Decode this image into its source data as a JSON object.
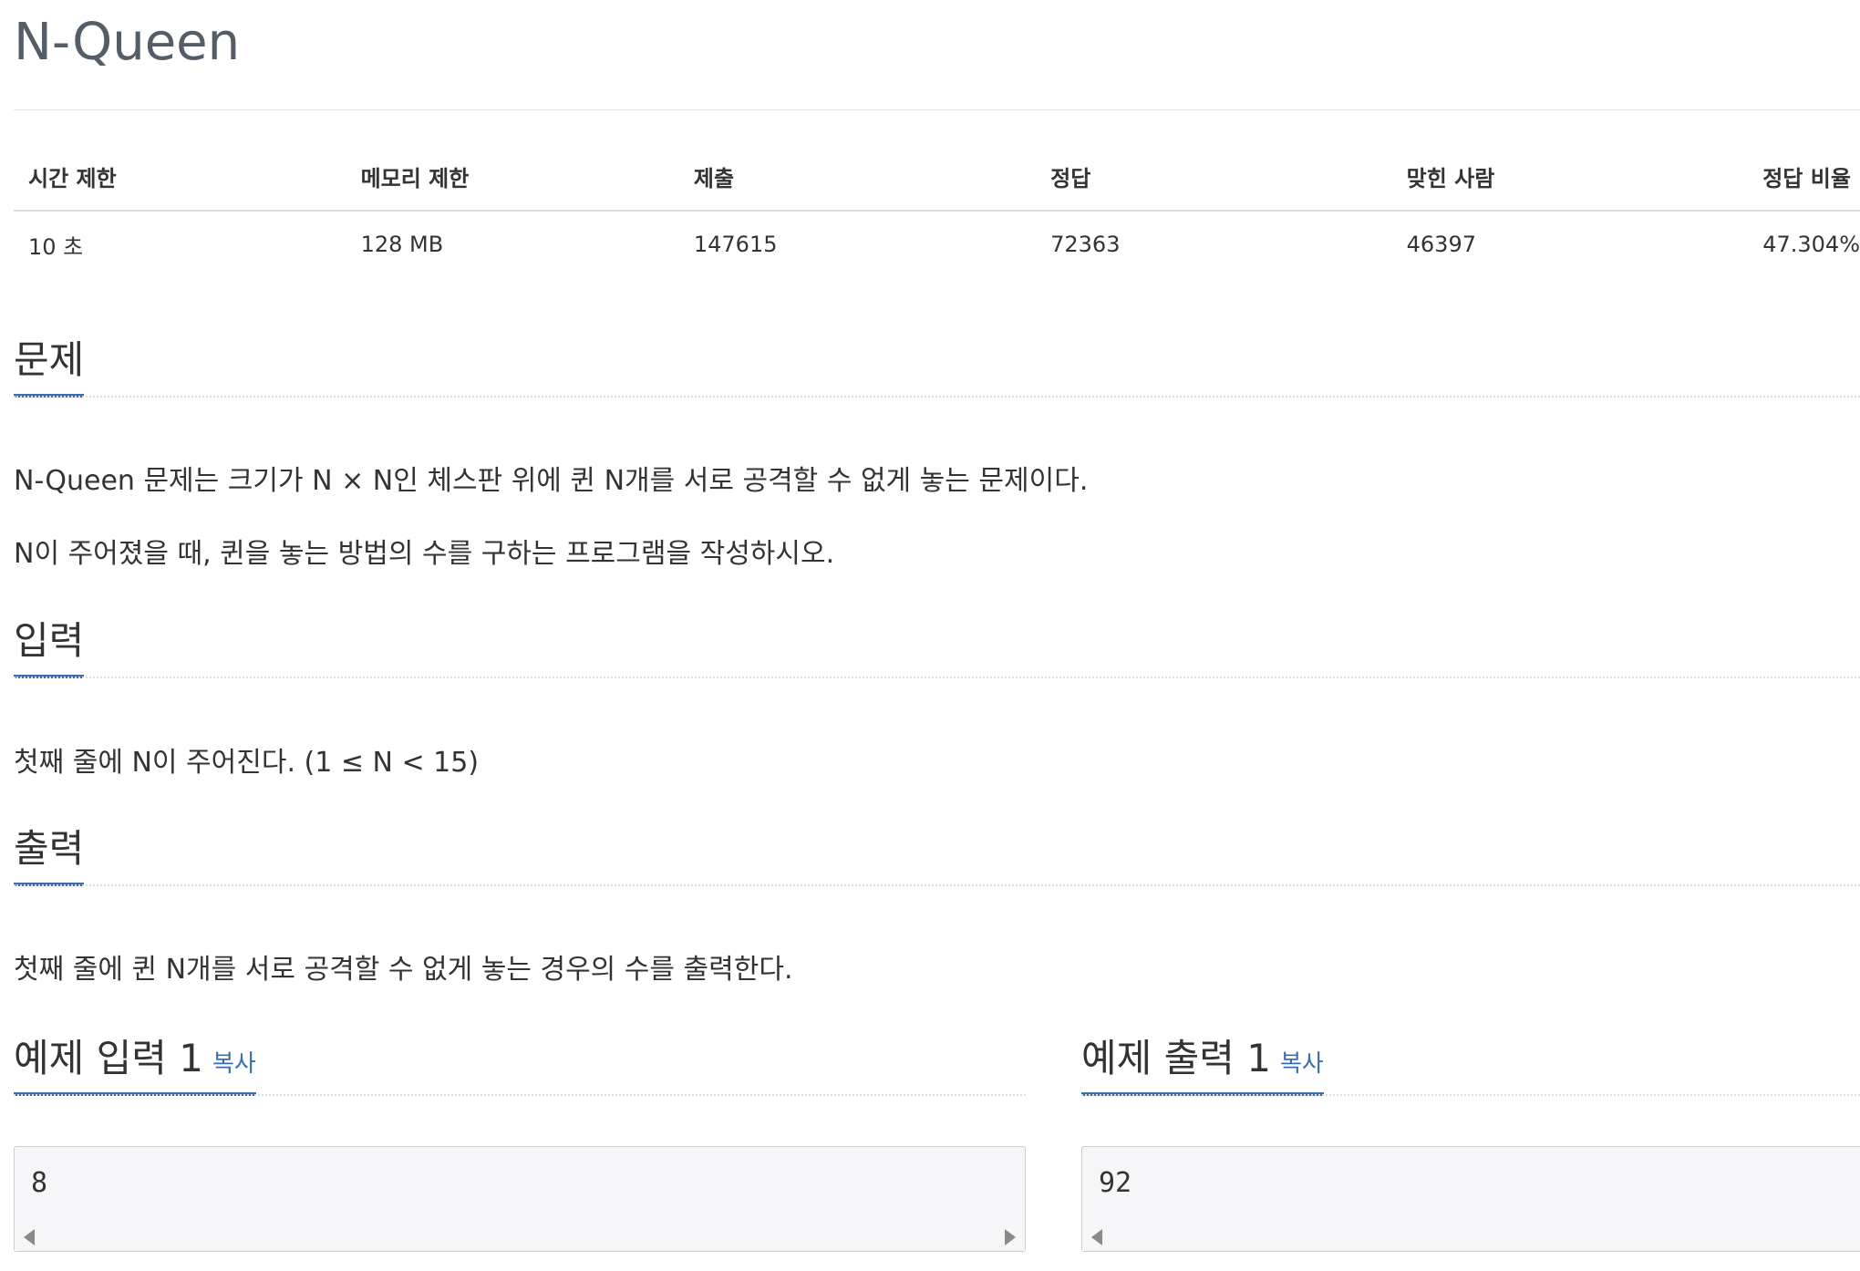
{
  "problem": {
    "title": "N-Queen"
  },
  "info_table": {
    "headers": [
      "시간 제한",
      "메모리 제한",
      "제출",
      "정답",
      "맞힌 사람",
      "정답 비율"
    ],
    "values": [
      "10 초",
      "128 MB",
      "147615",
      "72363",
      "46397",
      "47.304%"
    ]
  },
  "sections": {
    "description": {
      "heading": "문제",
      "paragraphs": [
        "N-Queen 문제는 크기가 N × N인 체스판 위에 퀸 N개를 서로 공격할 수 없게 놓는 문제이다.",
        "N이 주어졌을 때, 퀸을 놓는 방법의 수를 구하는 프로그램을 작성하시오."
      ]
    },
    "input": {
      "heading": "입력",
      "text": "첫째 줄에 N이 주어진다. (1 ≤ N < 15)"
    },
    "output": {
      "heading": "출력",
      "text": "첫째 줄에 퀸 N개를 서로 공격할 수 없게 놓는 경우의 수를 출력한다."
    }
  },
  "samples": {
    "input": {
      "heading": "예제 입력 1",
      "copy_label": "복사",
      "content": "8"
    },
    "output": {
      "heading": "예제 출력 1",
      "copy_label": "복사",
      "content": "92"
    }
  },
  "colors": {
    "accent": "#3b6eb0",
    "title": "#545d68",
    "text": "#333333",
    "sample_bg": "#f6f6f8"
  }
}
